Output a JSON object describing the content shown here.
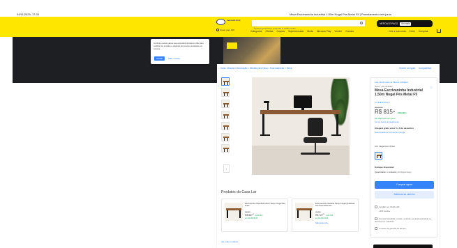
{
  "print_header": {
    "date": "04/11/2025, 17:33",
    "title": "Mesa Escrivaninha Industrial 1,50m Nogal Pés Metal F5 | Parcelamento sem juros"
  },
  "header": {
    "logo_text": "mercado livre",
    "location": "Enviar para 000",
    "search_placeholder": "Buscar produtos, marcas e muito mais...",
    "promo_text": "MERCADO PAGO",
    "promo_pill": "Ver mais",
    "nav": [
      "Categorias",
      "Ofertas",
      "Cupons",
      "Supermercado",
      "Moda",
      "Mercado Play",
      "Vender",
      "Contato"
    ],
    "nav_right": [
      "Crie a sua conta",
      "Entre",
      "Compras"
    ]
  },
  "cookie": {
    "text": "Confira o aviso para a sua experiência total em ML para verificar os cookies e páginas do serviço prestados em nossos.",
    "accept_label": "Aceitar",
    "config_label": "Mais opções"
  },
  "breadcrumb": {
    "path": "Casa, Móveis e Decoração > Móveis para Casa > Escrivaninhas > Mesa",
    "right": [
      "Vender um igual",
      "Compartilhar"
    ]
  },
  "product": {
    "store": "Loja oficial Casa Lar Móveis e Objetos",
    "condition": "Novo | +10 vendidos",
    "title": "Mesa Escrivaninha Industrial 1,50m Nogal Pés Metal F5",
    "rating": "4.8 ★★★★★ (7)",
    "old_price": "R$ 1.027",
    "price": "R$ 815",
    "cents": "99",
    "discount": "20% OFF",
    "installments": "10x R$ 81,59 sem juros",
    "payment_link": "Ver os meios de pagamento",
    "shipping": "Chegará grátis entre 5 e 8 de dezembro",
    "shipping_link": "Mais detalhes e formas de entrega",
    "color_label": "Cor: Nogal com Preto",
    "stock": "Estoque disponível",
    "quantity": "Quantidade: 1 unidade",
    "quantity_extra": "(+10 disponíveis)",
    "buy_label": "Comprar agora",
    "cart_label": "Adicionar ao carrinho",
    "seller": "Vendido por CASA LAR",
    "seller_sub": "+500 vendas",
    "protect": "Compra Garantida, receba o produto que está esperando ou devolvemos o dinheiro.",
    "warranty": "3 meses de garantia de fábrica"
  },
  "related": {
    "title": "Produtos do Casa Lar",
    "items": [
      {
        "name": "Escrivaninha Industrial 120cm Tampo Nogal Pés Preto",
        "old": "R$ 699",
        "price": "R$ 567",
        "cents": "99",
        "off": "18% OFF",
        "inst": "em 10x R$ 56,80"
      },
      {
        "name": "Escrivaninha Industrial Tampo Nogal Quadrada Pés Preto 90cm F5",
        "old": "R$ 829",
        "price": "R$ 727",
        "cents": "99",
        "off": "12% OFF",
        "inst": "em 10x R$ 72,80",
        "link": "Saiba mais sobre"
      }
    ],
    "see_more": "Ver mais produtos"
  },
  "colors": {
    "brand_yellow": "#ffe600",
    "primary_blue": "#3483fa",
    "discount_green": "#00a650",
    "hero_dark": "#1e1f22"
  }
}
